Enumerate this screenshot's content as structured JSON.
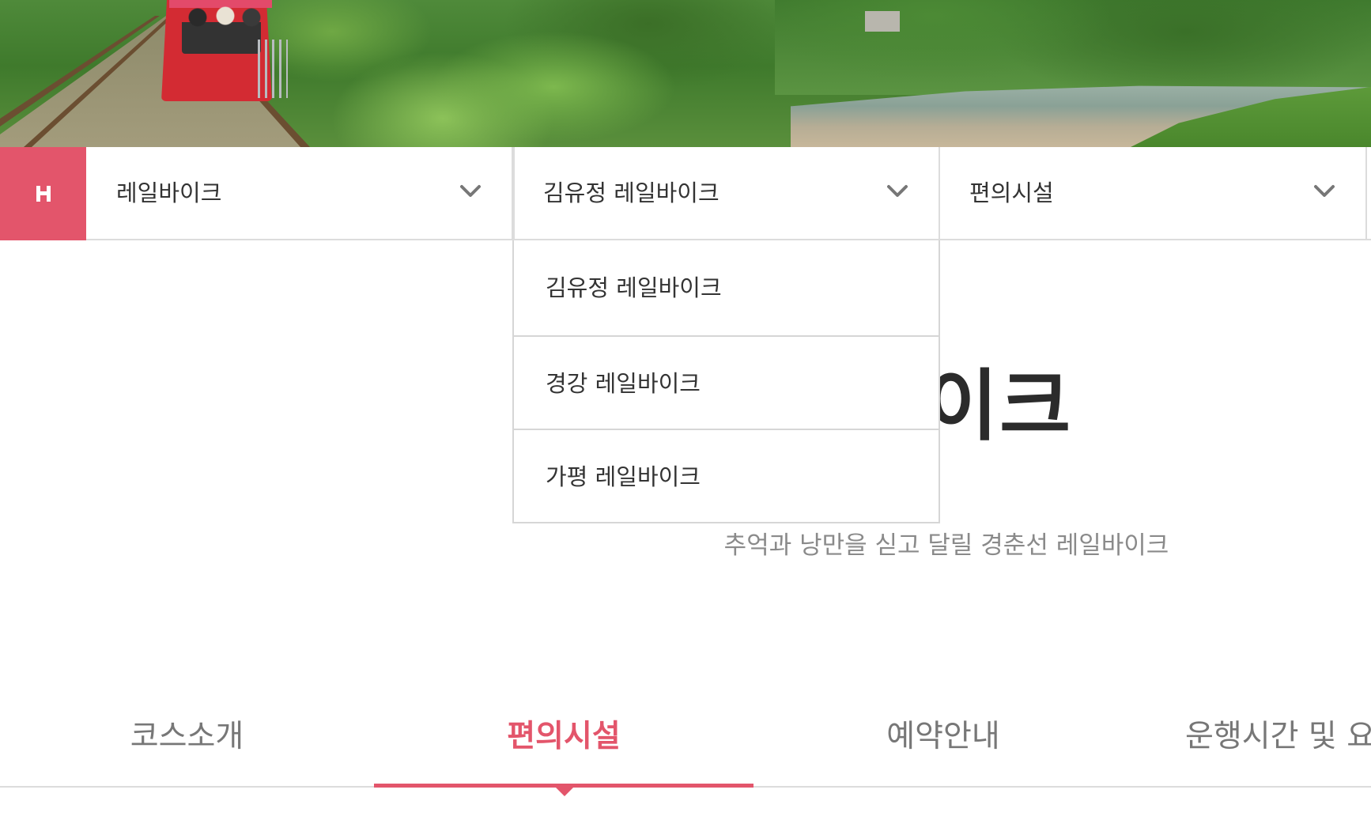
{
  "home": {
    "label": "H",
    "icon": "home-icon",
    "color": "#e3556b"
  },
  "location": {
    "level1": {
      "label": "레일바이크",
      "icon": "chevron-down-icon"
    },
    "level2": {
      "label": "김유정 레일바이크",
      "icon": "chevron-down-icon"
    },
    "level3": {
      "label": "편의시설",
      "icon": "chevron-down-icon"
    }
  },
  "dropdown": {
    "items": [
      {
        "label": "김유정 레일바이크"
      },
      {
        "label": "경강 레일바이크"
      },
      {
        "label": "가평 레일바이크"
      }
    ]
  },
  "page": {
    "title": "김유정 레일바이크",
    "title_visible": "일바이크",
    "subtitle": "추억과 낭만을 싣고 달릴 경춘선 레일바이크"
  },
  "tabs": [
    {
      "label": "코스소개",
      "active": false
    },
    {
      "label": "편의시설",
      "active": true
    },
    {
      "label": "예약안내",
      "active": false
    },
    {
      "label": "운행시간 및 요",
      "active": false
    }
  ],
  "colors": {
    "accent": "#e3556b",
    "text": "#333333",
    "muted": "#8a8a8a",
    "border": "#dcdcdc"
  }
}
